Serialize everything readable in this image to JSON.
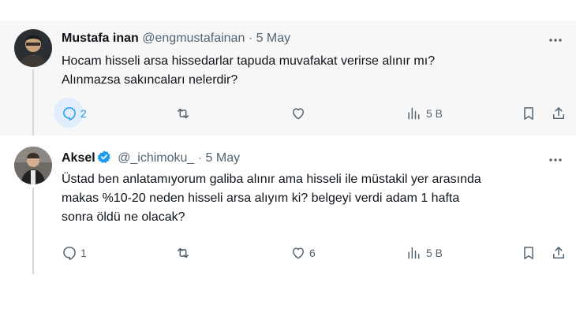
{
  "tweets": [
    {
      "display_name": "Mustafa inan",
      "handle": "@engmustafainan",
      "date": "· 5 May",
      "text_lines": [
        "Hocam hisseli arsa hissedarlar tapuda muvafakat verirse alınır mı?",
        "Alınmazsa sakıncaları nelerdir?"
      ],
      "replies": "2",
      "retweets": "",
      "likes": "",
      "views": "5 B",
      "verified": false
    },
    {
      "display_name": "Aksel",
      "handle": "@_ichimoku_",
      "date": "· 5 May",
      "text_lines": [
        "Üstad ben anlatamıyorum galiba alınır ama hisseli ile müstakil yer arasında",
        "makas %10-20 neden hisseli arsa alıyım ki? belgeyi verdi adam 1 hafta",
        "sonra öldü ne olacak?"
      ],
      "replies": "1",
      "retweets": "",
      "likes": "6",
      "views": "5 B",
      "verified": true
    }
  ],
  "colors": {
    "accent": "#1d9bf0",
    "muted": "#536471",
    "text": "#0f1419",
    "thread_line": "#cfd9de",
    "highlight_bg": "#f7f7f8"
  },
  "icons": [
    "reply-icon",
    "retweet-icon",
    "like-icon",
    "views-icon",
    "bookmark-icon",
    "share-icon",
    "more-icon",
    "verified-badge-icon"
  ]
}
